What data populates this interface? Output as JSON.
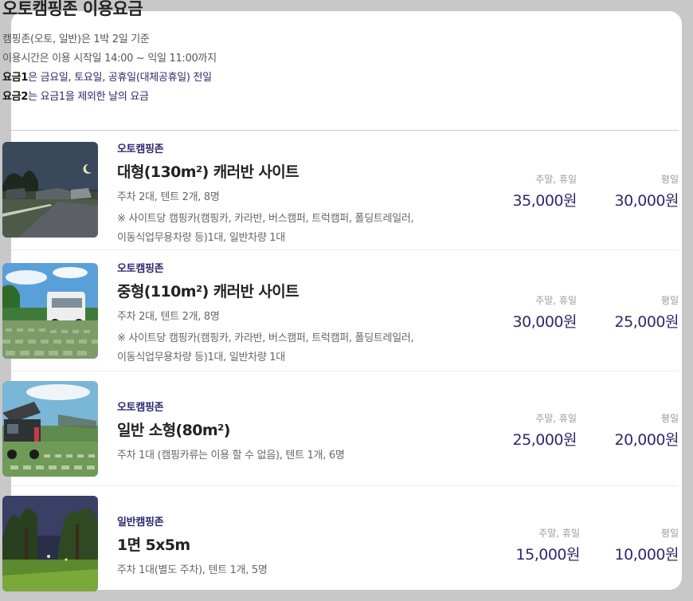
{
  "header": {
    "title": "오토캠핑존 이용요금",
    "line1": "캠핑존(오토, 일반)은 1박 2일 기준",
    "line2": "이용시간은 이용 시작일 14:00 ~ 익일 11:00까지",
    "line3_strong": "요금1",
    "line3_rest": "은 금요일, 토요일, 공휴일(대체공휴일) 전일",
    "line4_strong": "요금2",
    "line4_rest": "는 요금1을 제외한 날의 요금"
  },
  "sites": [
    {
      "category": "오토캠핑존",
      "name": "대형(130m²) 캐러반 사이트",
      "spec": "주차 2대, 텐트 2개, 8명",
      "note1": "※ 사이트당 캠핑카(캠핑카, 카라반, 버스캠퍼, 트럭캠퍼, 폴딩트레일러,",
      "note2": "이동식업무용차량 등)1대, 일반차량 1대",
      "weekend_label": "주말, 휴일",
      "weekend_price": "35,000원",
      "weekday_label": "평일",
      "weekday_price": "30,000원"
    },
    {
      "category": "오토캠핑존",
      "name": "중형(110m²) 캐러반 사이트",
      "spec": "주차 2대, 텐트 2개, 8명",
      "note1": "※ 사이트당 캠핑카(캠핑카, 카라반, 버스캠퍼, 트럭캠퍼, 폴딩트레일러,",
      "note2": "이동식업무용차량 등)1대, 일반차량 1대",
      "weekend_label": "주말, 휴일",
      "weekend_price": "30,000원",
      "weekday_label": "평일",
      "weekday_price": "25,000원"
    },
    {
      "category": "오토캠핑존",
      "name": "일반 소형(80m²)",
      "spec": "주차 1대 (캠핑카류는 이용 할 수 없음), 텐트 1개, 6명",
      "weekend_label": "주말, 휴일",
      "weekend_price": "25,000원",
      "weekday_label": "평일",
      "weekday_price": "20,000원"
    },
    {
      "category": "일반캠핑존",
      "name": "1면 5x5m",
      "spec": "주차 1대(별도 주차), 텐트 1개, 5명",
      "weekend_label": "주말, 휴일",
      "weekend_price": "15,000원",
      "weekday_label": "평일",
      "weekday_price": "10,000원"
    }
  ],
  "colors": {
    "accent_navy": "#2c2a6e",
    "page_bg": "#c8c8c8",
    "card_bg": "#ffffff"
  }
}
